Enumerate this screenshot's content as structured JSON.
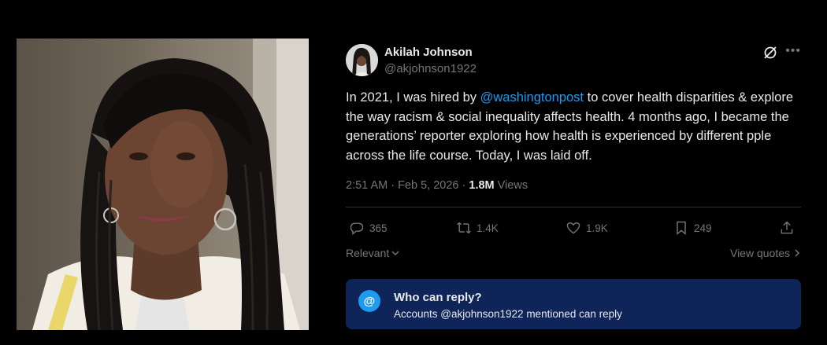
{
  "tweet": {
    "author_name": "Akilah Johnson",
    "author_handle": "@akjohnson1922",
    "text_before": "In 2021, I was hired by ",
    "mention": "@washingtonpost",
    "text_after": " to cover health disparities & explore the way racism & social inequality affects health. 4 months ago, I became the generations’ reporter exploring how health is experienced by different pple across the life course. Today, I was laid off.",
    "timestamp": "2:51 AM · Feb 5, 2026 · ",
    "views_count": "1.8M",
    "views_label": " Views"
  },
  "actions": {
    "replies": "365",
    "reposts": "1.4K",
    "likes": "1.9K",
    "bookmarks": "249"
  },
  "replies_section": {
    "sort_label": "Relevant",
    "view_quotes_label": "View quotes"
  },
  "reply_restriction": {
    "icon": "@",
    "title": "Who can reply?",
    "subtitle": "Accounts @akjohnson1922 mentioned can reply"
  },
  "colors": {
    "accent": "#1d9bf0",
    "muted": "#71767b",
    "reply_box_bg": "#0f2458"
  }
}
